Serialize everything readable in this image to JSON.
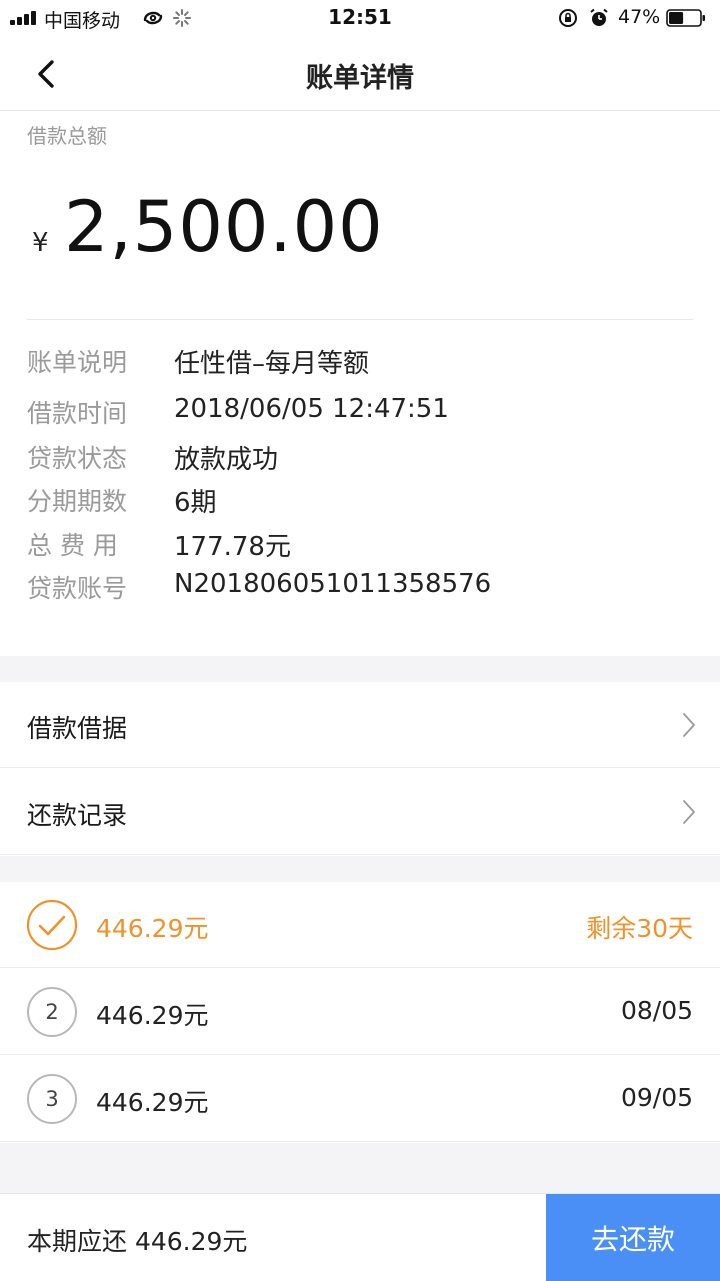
{
  "status_bar": {
    "carrier": "中国移动",
    "time": "12:51",
    "battery_percent": "47%",
    "battery_level": 0.47
  },
  "nav": {
    "title": "账单详情",
    "back_icon": "chevron-left-icon"
  },
  "summary": {
    "label": "借款总额",
    "currency": "¥",
    "amount": "2,500.00"
  },
  "details": [
    {
      "label": "账单说明",
      "value": "任性借–每月等额"
    },
    {
      "label": "借款时间",
      "value": "2018/06/05 12:47:51"
    },
    {
      "label": "贷款状态",
      "value": "放款成功"
    },
    {
      "label": "分期期数",
      "value": "6期"
    },
    {
      "label": "总 费 用",
      "value": "177.78元"
    },
    {
      "label": "贷款账号",
      "value": "N201806051011358576"
    }
  ],
  "links": [
    {
      "label": "借款借据",
      "icon": "chevron-right-icon"
    },
    {
      "label": "还款记录",
      "icon": "chevron-right-icon"
    }
  ],
  "installments": [
    {
      "number": "",
      "status": "current",
      "icon": "check-circle-icon",
      "amount": "446.29元",
      "right": "剩余30天",
      "accent": "#f0922b"
    },
    {
      "number": "2",
      "status": "upcoming",
      "amount": "446.29元",
      "right": "08/05"
    },
    {
      "number": "3",
      "status": "upcoming",
      "amount": "446.29元",
      "right": "09/05"
    }
  ],
  "bottom": {
    "due_label": "本期应还 446.29元",
    "repay_button": "去还款",
    "button_color": "#4a8ff5"
  }
}
